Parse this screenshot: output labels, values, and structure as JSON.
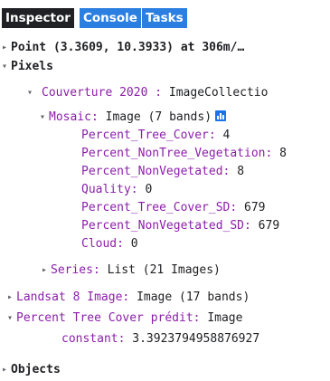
{
  "tabs": {
    "inspector": "Inspector",
    "console": "Console",
    "tasks": "Tasks"
  },
  "point": {
    "text": "Point (3.3609, 10.3933) at 306m/…"
  },
  "pixels": {
    "label": "Pixels",
    "collection": {
      "name": "Couverture 2020 :",
      "type": "ImageCollectio"
    },
    "mosaic": {
      "name": "Mosaic:",
      "type": "Image (7 bands)"
    },
    "bands": [
      {
        "name": "Percent_Tree_Cover:",
        "value": "4"
      },
      {
        "name": "Percent_NonTree_Vegetation:",
        "value": "8"
      },
      {
        "name": "Percent_NonVegetated:",
        "value": "8"
      },
      {
        "name": "Quality:",
        "value": "0"
      },
      {
        "name": "Percent_Tree_Cover_SD:",
        "value": "679"
      },
      {
        "name": "Percent_NonVegetated_SD:",
        "value": "679"
      },
      {
        "name": "Cloud:",
        "value": "0"
      }
    ],
    "series": {
      "name": "Series:",
      "type": "List (21 Images)"
    }
  },
  "landsat": {
    "name": "Landsat 8 Image:",
    "type": "Image (17 bands)"
  },
  "predicted": {
    "name": "Percent Tree Cover prédit:",
    "type": "Image",
    "constant_label": "constant:",
    "constant_value": "3.3923794958876927"
  },
  "objects": {
    "label": "Objects"
  }
}
